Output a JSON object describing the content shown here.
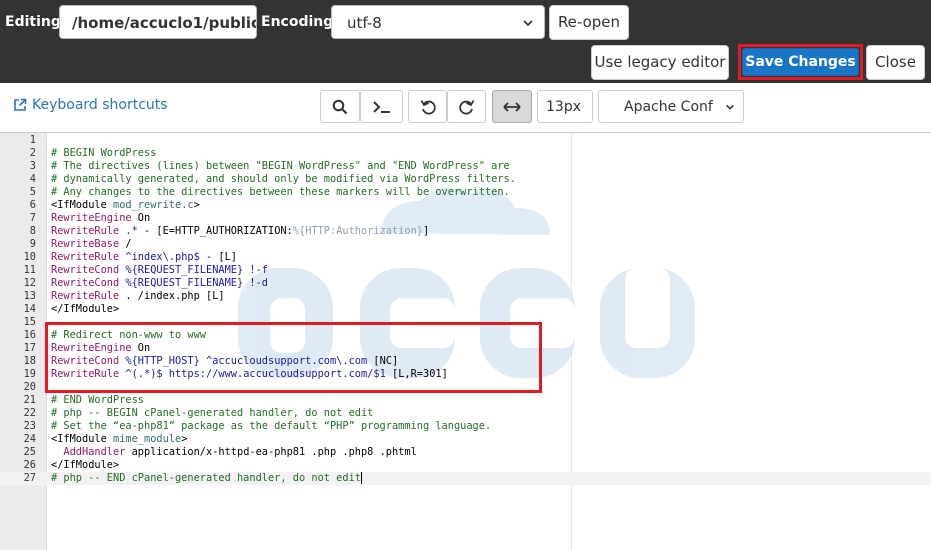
{
  "header": {
    "editing_label": "Editing:",
    "path_value": "/home/accuclo1/public_",
    "encoding_label": "Encoding:",
    "encoding_value": "utf-8",
    "reopen_label": "Re-open",
    "legacy_label": "Use legacy editor",
    "save_label": "Save Changes",
    "close_label": "Close"
  },
  "toolbar": {
    "shortcuts_label": "Keyboard shortcuts",
    "font_size": "13px",
    "mode": "Apache Conf"
  },
  "editor": {
    "lines": [
      {
        "n": "1",
        "tokens": []
      },
      {
        "n": "2",
        "tokens": [
          {
            "t": "# BEGIN WordPress",
            "c": "cm"
          }
        ]
      },
      {
        "n": "3",
        "tokens": [
          {
            "t": "# The directives (lines) between \"BEGIN WordPress\" and \"END WordPress\" are",
            "c": "cm"
          }
        ]
      },
      {
        "n": "4",
        "tokens": [
          {
            "t": "# dynamically generated, and should only be modified via WordPress filters.",
            "c": "cm"
          }
        ]
      },
      {
        "n": "5",
        "tokens": [
          {
            "t": "# Any changes to the directives between these markers will be overwritten.",
            "c": "cm"
          }
        ]
      },
      {
        "n": "6",
        "tokens": [
          {
            "t": "<IfModule ",
            "c": "tg"
          },
          {
            "t": "mod_rewrite.c",
            "c": "at"
          },
          {
            "t": ">",
            "c": "tg"
          }
        ]
      },
      {
        "n": "7",
        "tokens": [
          {
            "t": "RewriteEngine",
            "c": "kw"
          },
          {
            "t": " On",
            "c": ""
          }
        ]
      },
      {
        "n": "8",
        "tokens": [
          {
            "t": "RewriteRule",
            "c": "kw"
          },
          {
            "t": " ",
            "c": ""
          },
          {
            "t": ".*",
            "c": "st"
          },
          {
            "t": " - [E=HTTP_AUTHORIZATION:",
            "c": ""
          },
          {
            "t": "%{HTTP:Authorization}",
            "c": "va"
          },
          {
            "t": "]",
            "c": ""
          }
        ]
      },
      {
        "n": "9",
        "tokens": [
          {
            "t": "RewriteBase",
            "c": "kw"
          },
          {
            "t": " /",
            "c": ""
          }
        ]
      },
      {
        "n": "10",
        "tokens": [
          {
            "t": "RewriteRule",
            "c": "kw"
          },
          {
            "t": " ",
            "c": ""
          },
          {
            "t": "^index\\.php$",
            "c": "st"
          },
          {
            "t": " - [L]",
            "c": ""
          }
        ]
      },
      {
        "n": "11",
        "tokens": [
          {
            "t": "RewriteCond",
            "c": "kw"
          },
          {
            "t": " %{REQUEST_FILENAME}",
            "c": "st"
          },
          {
            "t": " !-f",
            "c": "st"
          }
        ]
      },
      {
        "n": "12",
        "tokens": [
          {
            "t": "RewriteCond",
            "c": "kw"
          },
          {
            "t": " %{REQUEST_FILENAME}",
            "c": "st"
          },
          {
            "t": " !-d",
            "c": "st"
          }
        ]
      },
      {
        "n": "13",
        "tokens": [
          {
            "t": "RewriteRule",
            "c": "kw"
          },
          {
            "t": " . /index.php [L]",
            "c": ""
          }
        ]
      },
      {
        "n": "14",
        "tokens": [
          {
            "t": "</IfModule>",
            "c": "tg"
          }
        ]
      },
      {
        "n": "15",
        "tokens": []
      },
      {
        "n": "16",
        "tokens": [
          {
            "t": "# Redirect non-www to www",
            "c": "cm"
          }
        ]
      },
      {
        "n": "17",
        "tokens": [
          {
            "t": "RewriteEngine",
            "c": "kw"
          },
          {
            "t": " On",
            "c": ""
          }
        ]
      },
      {
        "n": "18",
        "tokens": [
          {
            "t": "RewriteCond",
            "c": "kw"
          },
          {
            "t": " %{HTTP_HOST}",
            "c": "st"
          },
          {
            "t": " ^accucloudsupport.com\\.com",
            "c": "st"
          },
          {
            "t": " [NC]",
            "c": ""
          }
        ]
      },
      {
        "n": "19",
        "tokens": [
          {
            "t": "RewriteRule",
            "c": "kw"
          },
          {
            "t": " ",
            "c": ""
          },
          {
            "t": "^(.*)$",
            "c": "st"
          },
          {
            "t": " https://www.accucloudsupport.com/$1",
            "c": "st"
          },
          {
            "t": " [L,R=301]",
            "c": ""
          }
        ]
      },
      {
        "n": "20",
        "tokens": []
      },
      {
        "n": "21",
        "tokens": [
          {
            "t": "# END WordPress",
            "c": "cm"
          }
        ]
      },
      {
        "n": "22",
        "tokens": [
          {
            "t": "# php -- BEGIN cPanel-generated handler, do not edit",
            "c": "cm"
          }
        ]
      },
      {
        "n": "23",
        "tokens": [
          {
            "t": "# Set the “ea-php81” package as the default “PHP” programming language.",
            "c": "cm"
          }
        ]
      },
      {
        "n": "24",
        "tokens": [
          {
            "t": "<IfModule ",
            "c": "tg"
          },
          {
            "t": "mime_module",
            "c": "at"
          },
          {
            "t": ">",
            "c": "tg"
          }
        ]
      },
      {
        "n": "25",
        "tokens": [
          {
            "t": "  AddHandler",
            "c": "kw"
          },
          {
            "t": " application/x-httpd-ea-php81 .php .php8 .phtml",
            "c": ""
          }
        ]
      },
      {
        "n": "26",
        "tokens": [
          {
            "t": "</IfModule>",
            "c": "tg"
          }
        ]
      },
      {
        "n": "27",
        "tokens": [
          {
            "t": "# php -- END cPanel-generated handler, do not edit",
            "c": "cm"
          }
        ],
        "current": true
      }
    ]
  },
  "colors": {
    "topbar": "#333333",
    "primary_button": "#1976c6",
    "highlight_box": "#e01b24",
    "link": "#2a75bb"
  },
  "icons": [
    "external-link-icon",
    "search-icon",
    "terminal-icon",
    "undo-icon",
    "redo-icon",
    "wrap-icon",
    "chevron-down-icon"
  ]
}
